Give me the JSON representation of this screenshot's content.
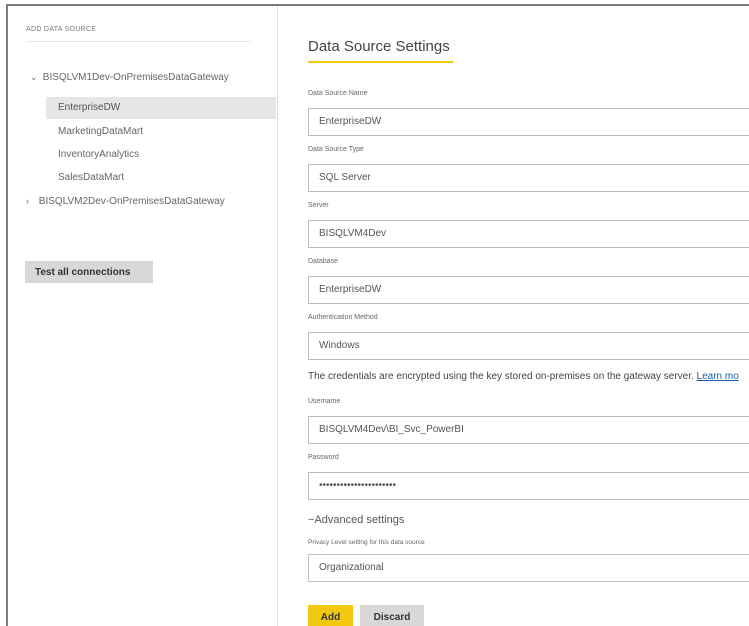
{
  "left_panel": {
    "section_title": "ADD DATA SOURCE",
    "gateways": [
      {
        "expanded_icon": "⌄",
        "name": "BISQLVM1Dev-OnPremisesDataGateway"
      },
      {
        "expanded_icon": "›",
        "name": "BISQLVM2Dev-OnPremisesDataGateway"
      }
    ],
    "data_sources": [
      "EnterpriseDW",
      "MarketingDataMart",
      "InventoryAnalytics",
      "SalesDataMart"
    ],
    "selected_index": 0,
    "test_button": "Test all connections"
  },
  "settings": {
    "title": "Data Source Settings",
    "name_label": "Data Source Name",
    "name_value": "EnterpriseDW",
    "type_label": "Data Source Type",
    "type_value": "SQL Server",
    "server_label": "Server",
    "server_value": "BISQLVM4Dev",
    "database_label": "Database",
    "database_value": "EnterpriseDW",
    "auth_label": "Authentication Method",
    "auth_value": "Windows",
    "credentials_note": "The credentials are encrypted using the key stored on-premises on the gateway server.",
    "learn_more": "Learn mo",
    "username_label": "Username",
    "username_value": "BISQLVM4Dev\\BI_Svc_PowerBI",
    "password_label": "Password",
    "password_value": "••••••••••••••••••••••",
    "advanced_label": "Advanced settings",
    "advanced_icon": "−",
    "privacy_label": "Privacy Level setting for this data source",
    "privacy_value": "Organizational",
    "dropdown_arrow": "▼"
  },
  "buttons": {
    "add": "Add",
    "discard": "Discard"
  },
  "colors": {
    "accent": "#f2c811",
    "selected_bg": "#e6e6e6",
    "button_gray": "#d8d8d8",
    "link": "#1a5ea8"
  }
}
